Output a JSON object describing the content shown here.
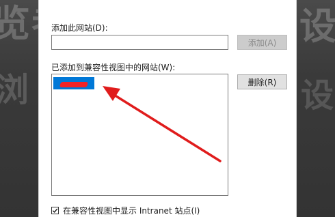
{
  "dialog": {
    "add_site_label": "添加此网站(D):",
    "add_site_value": "",
    "add_site_placeholder": "",
    "add_button_label": "添加(A)",
    "added_sites_label": "已添加到兼容性视图中的网站(W):",
    "delete_button_label": "删除(R)",
    "intranet_checkbox_label": "在兼容性视图中显示 Intranet 站点(I)",
    "intranet_checkbox_checked": true
  },
  "added_sites": [
    {
      "label": "",
      "selected": true
    }
  ],
  "background": {
    "left_glyphs_1": "览者",
    "left_glyphs_2": "浏",
    "right_glyphs_1": "设",
    "right_glyphs_2": "设"
  },
  "colors": {
    "selection": "#0078d7",
    "annotation_red": "#e01c1c",
    "dialog_bg": "#ffffff",
    "disabled_button_bg": "#cccccc"
  }
}
